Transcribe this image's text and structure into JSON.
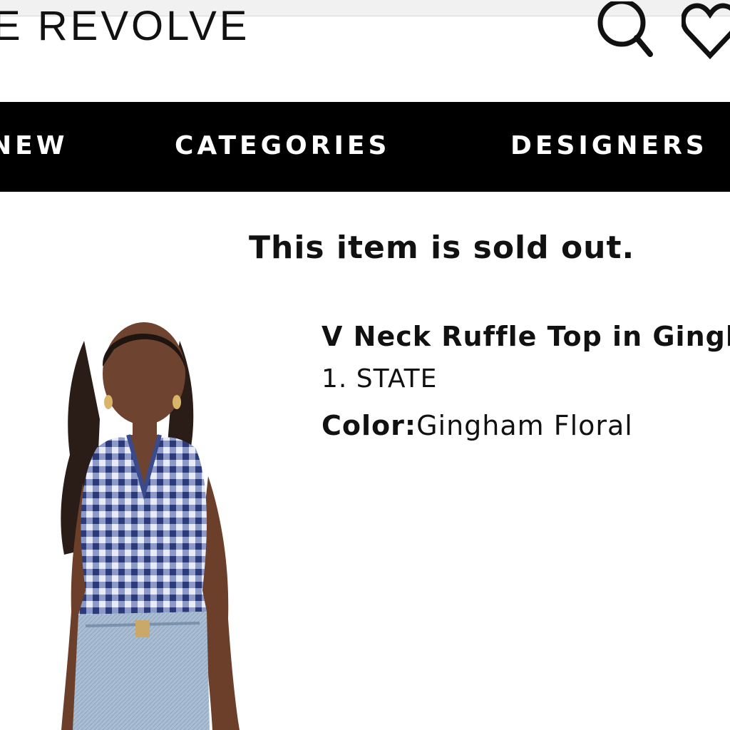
{
  "header": {
    "logo_text": "E REVOLVE",
    "icons": [
      "search-icon",
      "heart-icon"
    ]
  },
  "nav": {
    "items": [
      {
        "label": "NEW"
      },
      {
        "label": "CATEGORIES"
      },
      {
        "label": "DESIGNERS"
      }
    ]
  },
  "notice": {
    "sold_out": "This item is sold out."
  },
  "product": {
    "title": "V Neck Ruffle Top in Gingham Floral",
    "brand": "1. STATE",
    "color_label": "Color:",
    "color_value": "Gingham Floral",
    "image_alt_icon": "product-photo"
  },
  "colors": {
    "nav_background": "#000000",
    "nav_text": "#ffffff",
    "text": "#111111",
    "top_top_gingham": "#3f4f8c",
    "jeans": "#9fb4cc"
  }
}
